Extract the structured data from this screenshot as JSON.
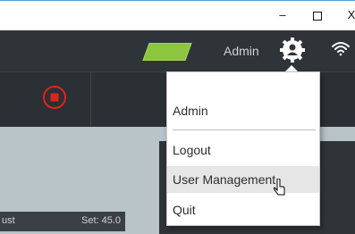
{
  "window": {
    "minimize_glyph": "–",
    "close_glyph": "X"
  },
  "header": {
    "user_name": "Admin",
    "status_color": "#8cc63f",
    "avatar_icon": "user-settings-icon",
    "wifi_icon": "wifi-icon"
  },
  "toolbar": {
    "stop_icon": "stop-record-icon",
    "stop_color": "#e2231a"
  },
  "bottom": {
    "left_text": "ust",
    "set_text": "Set: 45.0"
  },
  "menu": {
    "header": "Admin",
    "items": [
      "Logout",
      "User Management",
      "Quit"
    ],
    "hovered": "User Management"
  }
}
